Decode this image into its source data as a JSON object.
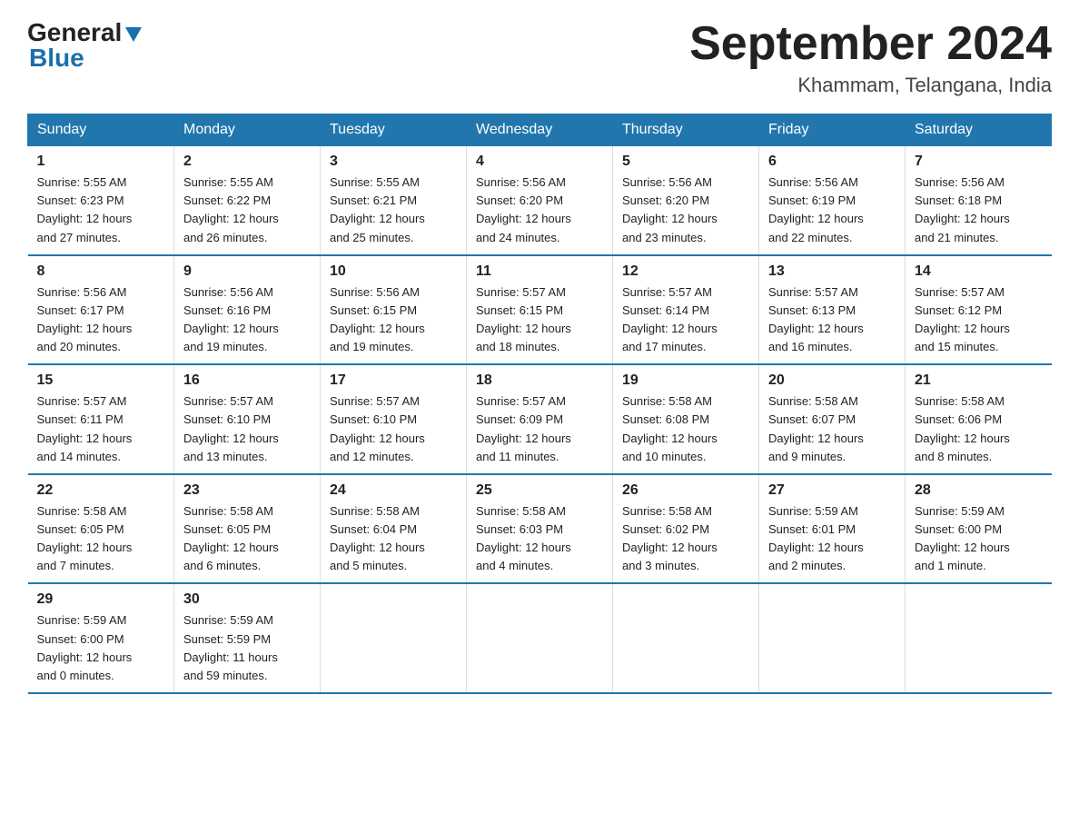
{
  "header": {
    "logo": {
      "general": "General",
      "blue": "Blue",
      "triangle": "▲"
    },
    "title": "September 2024",
    "subtitle": "Khammam, Telangana, India"
  },
  "days_of_week": [
    "Sunday",
    "Monday",
    "Tuesday",
    "Wednesday",
    "Thursday",
    "Friday",
    "Saturday"
  ],
  "weeks": [
    [
      {
        "day": "1",
        "info": "Sunrise: 5:55 AM\nSunset: 6:23 PM\nDaylight: 12 hours\nand 27 minutes."
      },
      {
        "day": "2",
        "info": "Sunrise: 5:55 AM\nSunset: 6:22 PM\nDaylight: 12 hours\nand 26 minutes."
      },
      {
        "day": "3",
        "info": "Sunrise: 5:55 AM\nSunset: 6:21 PM\nDaylight: 12 hours\nand 25 minutes."
      },
      {
        "day": "4",
        "info": "Sunrise: 5:56 AM\nSunset: 6:20 PM\nDaylight: 12 hours\nand 24 minutes."
      },
      {
        "day": "5",
        "info": "Sunrise: 5:56 AM\nSunset: 6:20 PM\nDaylight: 12 hours\nand 23 minutes."
      },
      {
        "day": "6",
        "info": "Sunrise: 5:56 AM\nSunset: 6:19 PM\nDaylight: 12 hours\nand 22 minutes."
      },
      {
        "day": "7",
        "info": "Sunrise: 5:56 AM\nSunset: 6:18 PM\nDaylight: 12 hours\nand 21 minutes."
      }
    ],
    [
      {
        "day": "8",
        "info": "Sunrise: 5:56 AM\nSunset: 6:17 PM\nDaylight: 12 hours\nand 20 minutes."
      },
      {
        "day": "9",
        "info": "Sunrise: 5:56 AM\nSunset: 6:16 PM\nDaylight: 12 hours\nand 19 minutes."
      },
      {
        "day": "10",
        "info": "Sunrise: 5:56 AM\nSunset: 6:15 PM\nDaylight: 12 hours\nand 19 minutes."
      },
      {
        "day": "11",
        "info": "Sunrise: 5:57 AM\nSunset: 6:15 PM\nDaylight: 12 hours\nand 18 minutes."
      },
      {
        "day": "12",
        "info": "Sunrise: 5:57 AM\nSunset: 6:14 PM\nDaylight: 12 hours\nand 17 minutes."
      },
      {
        "day": "13",
        "info": "Sunrise: 5:57 AM\nSunset: 6:13 PM\nDaylight: 12 hours\nand 16 minutes."
      },
      {
        "day": "14",
        "info": "Sunrise: 5:57 AM\nSunset: 6:12 PM\nDaylight: 12 hours\nand 15 minutes."
      }
    ],
    [
      {
        "day": "15",
        "info": "Sunrise: 5:57 AM\nSunset: 6:11 PM\nDaylight: 12 hours\nand 14 minutes."
      },
      {
        "day": "16",
        "info": "Sunrise: 5:57 AM\nSunset: 6:10 PM\nDaylight: 12 hours\nand 13 minutes."
      },
      {
        "day": "17",
        "info": "Sunrise: 5:57 AM\nSunset: 6:10 PM\nDaylight: 12 hours\nand 12 minutes."
      },
      {
        "day": "18",
        "info": "Sunrise: 5:57 AM\nSunset: 6:09 PM\nDaylight: 12 hours\nand 11 minutes."
      },
      {
        "day": "19",
        "info": "Sunrise: 5:58 AM\nSunset: 6:08 PM\nDaylight: 12 hours\nand 10 minutes."
      },
      {
        "day": "20",
        "info": "Sunrise: 5:58 AM\nSunset: 6:07 PM\nDaylight: 12 hours\nand 9 minutes."
      },
      {
        "day": "21",
        "info": "Sunrise: 5:58 AM\nSunset: 6:06 PM\nDaylight: 12 hours\nand 8 minutes."
      }
    ],
    [
      {
        "day": "22",
        "info": "Sunrise: 5:58 AM\nSunset: 6:05 PM\nDaylight: 12 hours\nand 7 minutes."
      },
      {
        "day": "23",
        "info": "Sunrise: 5:58 AM\nSunset: 6:05 PM\nDaylight: 12 hours\nand 6 minutes."
      },
      {
        "day": "24",
        "info": "Sunrise: 5:58 AM\nSunset: 6:04 PM\nDaylight: 12 hours\nand 5 minutes."
      },
      {
        "day": "25",
        "info": "Sunrise: 5:58 AM\nSunset: 6:03 PM\nDaylight: 12 hours\nand 4 minutes."
      },
      {
        "day": "26",
        "info": "Sunrise: 5:58 AM\nSunset: 6:02 PM\nDaylight: 12 hours\nand 3 minutes."
      },
      {
        "day": "27",
        "info": "Sunrise: 5:59 AM\nSunset: 6:01 PM\nDaylight: 12 hours\nand 2 minutes."
      },
      {
        "day": "28",
        "info": "Sunrise: 5:59 AM\nSunset: 6:00 PM\nDaylight: 12 hours\nand 1 minute."
      }
    ],
    [
      {
        "day": "29",
        "info": "Sunrise: 5:59 AM\nSunset: 6:00 PM\nDaylight: 12 hours\nand 0 minutes."
      },
      {
        "day": "30",
        "info": "Sunrise: 5:59 AM\nSunset: 5:59 PM\nDaylight: 11 hours\nand 59 minutes."
      },
      {
        "day": "",
        "info": ""
      },
      {
        "day": "",
        "info": ""
      },
      {
        "day": "",
        "info": ""
      },
      {
        "day": "",
        "info": ""
      },
      {
        "day": "",
        "info": ""
      }
    ]
  ]
}
